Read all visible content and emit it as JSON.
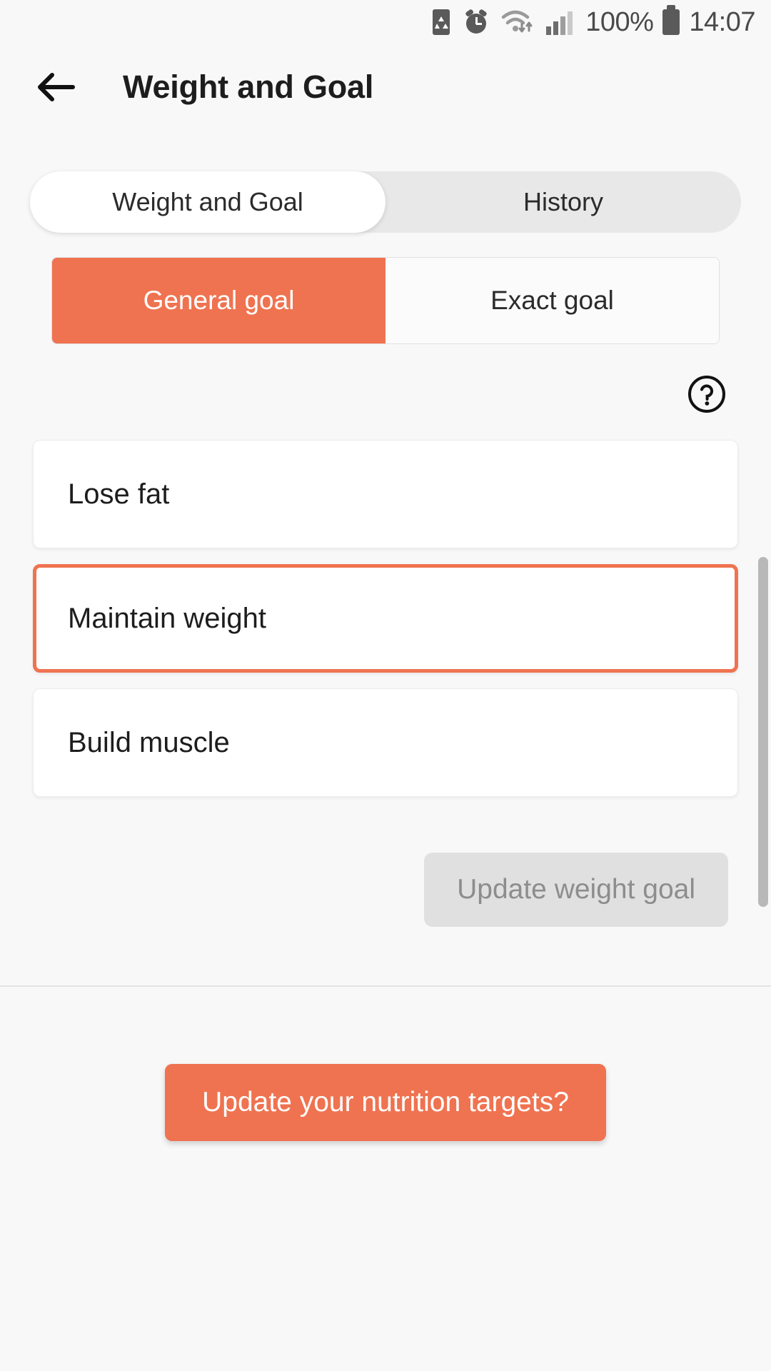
{
  "statusbar": {
    "battery_percent": "100%",
    "time": "14:07",
    "icons": [
      "recycle-doc-icon",
      "alarm-icon",
      "wifi-icon",
      "signal-icon",
      "battery-icon"
    ]
  },
  "appbar": {
    "back_icon": "back-arrow-icon",
    "title": "Weight and Goal"
  },
  "tabs": [
    {
      "label": "Weight and Goal",
      "active": true
    },
    {
      "label": "History",
      "active": false
    }
  ],
  "segmented": [
    {
      "label": "General goal",
      "selected": true
    },
    {
      "label": "Exact goal",
      "selected": false
    }
  ],
  "help": {
    "icon": "help-circle-icon"
  },
  "goal_options": [
    {
      "label": "Lose fat",
      "selected": false
    },
    {
      "label": "Maintain weight",
      "selected": true
    },
    {
      "label": "Build muscle",
      "selected": false
    }
  ],
  "update_button": {
    "label": "Update weight goal",
    "enabled": false
  },
  "cta_button": {
    "label": "Update your nutrition targets?"
  },
  "colors": {
    "accent": "#ef7350",
    "page_bg": "#f8f8f8",
    "card_bg": "#ffffff",
    "tab_track": "#e8e8e8",
    "disabled_bg": "#e0e0e0",
    "disabled_text": "#8d8d8d"
  }
}
